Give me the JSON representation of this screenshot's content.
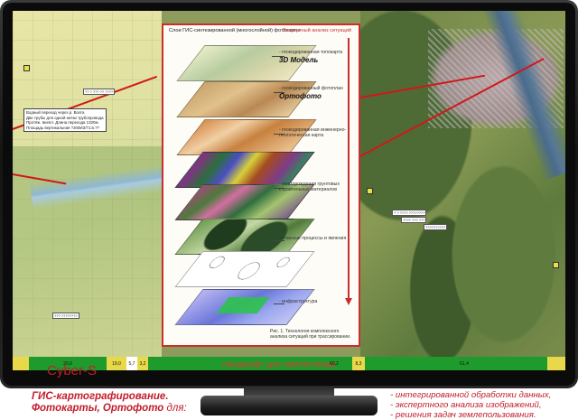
{
  "monitor": {
    "panel": {
      "title": "Слои ГИС-синтезированной (многослойной) фотокарты",
      "top_right": "Экспертный анализ ситуаций",
      "layers": [
        {
          "line1": "- геокодированная топокарта",
          "line2": "3D Модель"
        },
        {
          "line1": "- геокодированный фотоплан",
          "line2": "Ортофото"
        },
        {
          "line1": "- геокодированная инженерно-",
          "line2": "геологическая карта"
        },
        {
          "line1": "- месторождения грунтовых",
          "line2": "строительных материалов"
        },
        {
          "line1": "- опасные процессы и явления",
          "line2": ""
        },
        {
          "line1": "- инфраструктура",
          "line2": ""
        }
      ],
      "caption": "Рис. 1. Технология комплексного анализа ситуаций при трассировании."
    },
    "map_note": {
      "lines": [
        "Водный переход через р. Волга",
        "Две трубы для одной нитки трубопровода",
        "Протяж. внепл. Длина перехода 1320м.",
        "Площадь вертикальная ?200ИЗ/?1:в.??"
      ]
    },
    "map_tags": [
      "?? ? ??? ?? ????",
      "??? ????????",
      "? ? ???? ????????",
      "???? ??? ???",
      "??????????"
    ],
    "strip": {
      "title": "ландшафт для землеотвода",
      "values": [
        "20,6",
        "19,0",
        "5,7",
        "3,2",
        "60,2",
        "8,3",
        "61,4"
      ]
    }
  },
  "brand": "Cyber-S",
  "headline": {
    "line1": "ГИС-картографирование.",
    "line2": "Фотокарты, Ортофото",
    "suffix": " для:"
  },
  "bullets": [
    "- интегрированной обработки данных,",
    "- экспертного анализа изображений,",
    "- решения задач землепользования."
  ],
  "colors": {
    "accent_red": "#c21d2b",
    "strip_green": "#1f9a2c",
    "panel_border": "#c9302c"
  }
}
